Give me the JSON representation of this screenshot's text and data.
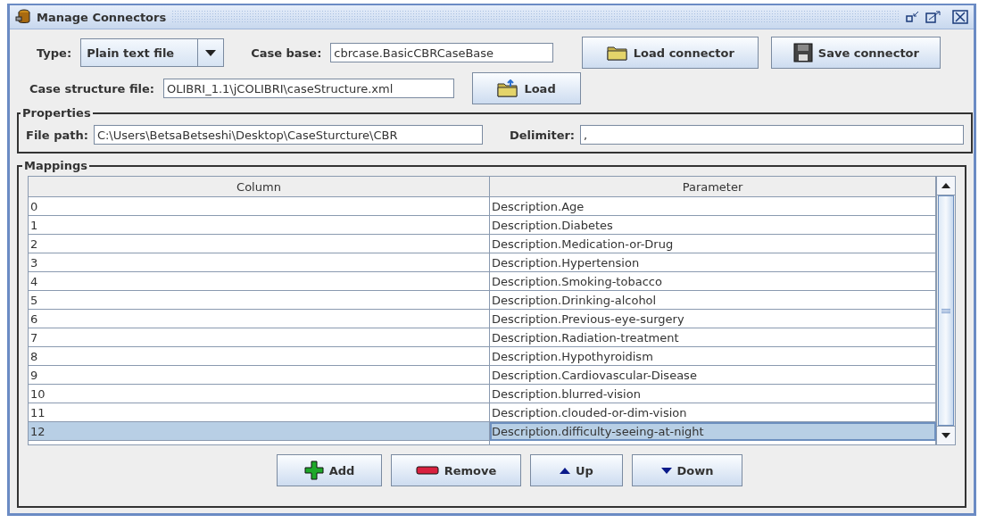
{
  "window": {
    "title": "Manage Connectors"
  },
  "type": {
    "label": "Type:",
    "value": "Plain text file"
  },
  "case_base": {
    "label": "Case base:",
    "value": "cbrcase.BasicCBRCaseBase"
  },
  "top_buttons": [
    {
      "label": "Load connector",
      "kind": "folder"
    },
    {
      "label": "Save connector",
      "kind": "disk"
    }
  ],
  "case_structure": {
    "label": "Case structure file:",
    "value": "OLIBRI_1.1\\jCOLIBRI\\caseStructure.xml",
    "button": {
      "label": "Load",
      "kind": "open"
    }
  },
  "properties": {
    "title": "Properties",
    "file_path": {
      "label": "File path:",
      "value": "C:\\Users\\BetsaBetseshi\\Desktop\\CaseSturcture\\CBR"
    },
    "delimiter": {
      "label": "Delimiter:",
      "value": ","
    }
  },
  "mappings": {
    "title": "Mappings",
    "columns": [
      "Column",
      "Parameter"
    ],
    "rows": [
      {
        "column": "0",
        "parameter": "Description.Age",
        "selected": false
      },
      {
        "column": "1",
        "parameter": "Description.Diabetes",
        "selected": false
      },
      {
        "column": "2",
        "parameter": "Description.Medication-or-Drug",
        "selected": false
      },
      {
        "column": "3",
        "parameter": "Description.Hypertension",
        "selected": false
      },
      {
        "column": "4",
        "parameter": "Description.Smoking-tobacco",
        "selected": false
      },
      {
        "column": "5",
        "parameter": "Description.Drinking-alcohol",
        "selected": false
      },
      {
        "column": "6",
        "parameter": "Description.Previous-eye-surgery",
        "selected": false
      },
      {
        "column": "7",
        "parameter": "Description.Radiation-treatment",
        "selected": false
      },
      {
        "column": "8",
        "parameter": "Description.Hypothyroidism",
        "selected": false
      },
      {
        "column": "9",
        "parameter": "Description.Cardiovascular-Disease",
        "selected": false
      },
      {
        "column": "10",
        "parameter": "Description.blurred-vision",
        "selected": false
      },
      {
        "column": "11",
        "parameter": "Description.clouded-or-dim-vision",
        "selected": false
      },
      {
        "column": "12",
        "parameter": "Description.difficulty-seeing-at-night",
        "selected": true
      }
    ]
  },
  "bottom_buttons": [
    {
      "label": "Add",
      "kind": "add"
    },
    {
      "label": "Remove",
      "kind": "remove"
    },
    {
      "label": "Up",
      "kind": "up"
    },
    {
      "label": "Down",
      "kind": "down"
    }
  ]
}
